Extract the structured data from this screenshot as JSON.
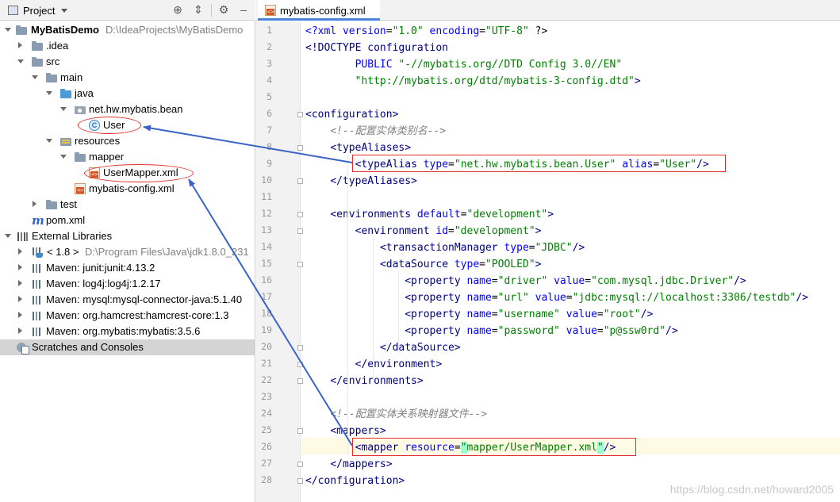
{
  "project_panel": {
    "title": "Project",
    "tree": [
      {
        "label": "MyBatisDemo",
        "path": "D:\\IdeaProjects\\MyBatisDemo"
      },
      {
        "label": ".idea"
      },
      {
        "label": "src"
      },
      {
        "label": "main"
      },
      {
        "label": "java"
      },
      {
        "label": "net.hw.mybatis.bean"
      },
      {
        "label": "User"
      },
      {
        "label": "resources"
      },
      {
        "label": "mapper"
      },
      {
        "label": "UserMapper.xml"
      },
      {
        "label": "mybatis-config.xml"
      },
      {
        "label": "test"
      },
      {
        "label": "pom.xml"
      },
      {
        "label": "External Libraries"
      },
      {
        "label": "< 1.8 >",
        "path": "D:\\Program Files\\Java\\jdk1.8.0_231"
      },
      {
        "label": "Maven: junit:junit:4.13.2"
      },
      {
        "label": "Maven: log4j:log4j:1.2.17"
      },
      {
        "label": "Maven: mysql:mysql-connector-java:5.1.40"
      },
      {
        "label": "Maven: org.hamcrest:hamcrest-core:1.3"
      },
      {
        "label": "Maven: org.mybatis:mybatis:3.5.6"
      },
      {
        "label": "Scratches and Consoles"
      }
    ]
  },
  "editor": {
    "tab_label": "mybatis-config.xml",
    "line_numbers": [
      "1",
      "2",
      "3",
      "4",
      "5",
      "6",
      "7",
      "8",
      "9",
      "10",
      "11",
      "12",
      "13",
      "14",
      "15",
      "16",
      "17",
      "18",
      "19",
      "20",
      "21",
      "22",
      "23",
      "24",
      "25",
      "26",
      "27",
      "28"
    ],
    "lines": [
      [
        [
          "?",
          "<?"
        ],
        [
          "attr",
          "xml version"
        ],
        [
          "",
          "="
        ],
        [
          "val",
          "\"1.0\""
        ],
        [
          "attr",
          " encoding"
        ],
        [
          "",
          "="
        ],
        [
          "val",
          "\"UTF-8\""
        ],
        [
          "",
          " ?>"
        ]
      ],
      [
        [
          "tag",
          "<!DOCTYPE configuration"
        ]
      ],
      [
        [
          "",
          "        "
        ],
        [
          "doc",
          "PUBLIC "
        ],
        [
          "val",
          "\"-//mybatis.org//DTD Config 3.0//EN\""
        ]
      ],
      [
        [
          "",
          "        "
        ],
        [
          "val",
          "\"http://mybatis.org/dtd/mybatis-3-config.dtd\""
        ],
        [
          "tag",
          ">"
        ]
      ],
      [],
      [
        [
          "tag",
          "<configuration>"
        ]
      ],
      [
        [
          "",
          "    "
        ],
        [
          "cmt",
          "<!--配置实体类别名-->"
        ]
      ],
      [
        [
          "",
          "    "
        ],
        [
          "tag",
          "<typeAliases>"
        ]
      ],
      [
        [
          "",
          "        "
        ],
        [
          "tag",
          "<typeAlias"
        ],
        [
          "attr",
          " type"
        ],
        [
          "",
          "="
        ],
        [
          "val",
          "\"net.hw.mybatis.bean.User\""
        ],
        [
          "attr",
          " alias"
        ],
        [
          "",
          "="
        ],
        [
          "val",
          "\"User\""
        ],
        [
          "tag",
          "/>"
        ]
      ],
      [
        [
          "",
          "    "
        ],
        [
          "tag",
          "</typeAliases>"
        ]
      ],
      [],
      [
        [
          "",
          "    "
        ],
        [
          "tag",
          "<environments"
        ],
        [
          "attr",
          " default"
        ],
        [
          "",
          "="
        ],
        [
          "val",
          "\"development\""
        ],
        [
          "tag",
          ">"
        ]
      ],
      [
        [
          "",
          "        "
        ],
        [
          "tag",
          "<environment"
        ],
        [
          "attr",
          " id"
        ],
        [
          "",
          "="
        ],
        [
          "val",
          "\"development\""
        ],
        [
          "tag",
          ">"
        ]
      ],
      [
        [
          "",
          "            "
        ],
        [
          "tag",
          "<transactionManager"
        ],
        [
          "attr",
          " type"
        ],
        [
          "",
          "="
        ],
        [
          "val",
          "\"JDBC\""
        ],
        [
          "tag",
          "/>"
        ]
      ],
      [
        [
          "",
          "            "
        ],
        [
          "tag",
          "<dataSource"
        ],
        [
          "attr",
          " type"
        ],
        [
          "",
          "="
        ],
        [
          "val",
          "\"POOLED\""
        ],
        [
          "tag",
          ">"
        ]
      ],
      [
        [
          "",
          "                "
        ],
        [
          "tag",
          "<property"
        ],
        [
          "attr",
          " name"
        ],
        [
          "",
          "="
        ],
        [
          "val",
          "\"driver\""
        ],
        [
          "attr",
          " value"
        ],
        [
          "",
          "="
        ],
        [
          "val",
          "\"com.mysql.jdbc.Driver\""
        ],
        [
          "tag",
          "/>"
        ]
      ],
      [
        [
          "",
          "                "
        ],
        [
          "tag",
          "<property"
        ],
        [
          "attr",
          " name"
        ],
        [
          "",
          "="
        ],
        [
          "val",
          "\"url\""
        ],
        [
          "attr",
          " value"
        ],
        [
          "",
          "="
        ],
        [
          "val",
          "\"jdbc:mysql://localhost:3306/testdb\""
        ],
        [
          "tag",
          "/>"
        ]
      ],
      [
        [
          "",
          "                "
        ],
        [
          "tag",
          "<property"
        ],
        [
          "attr",
          " name"
        ],
        [
          "",
          "="
        ],
        [
          "val",
          "\"username\""
        ],
        [
          "attr",
          " value"
        ],
        [
          "",
          "="
        ],
        [
          "val",
          "\"root\""
        ],
        [
          "tag",
          "/>"
        ]
      ],
      [
        [
          "",
          "                "
        ],
        [
          "tag",
          "<property"
        ],
        [
          "attr",
          " name"
        ],
        [
          "",
          "="
        ],
        [
          "val",
          "\"password\""
        ],
        [
          "attr",
          " value"
        ],
        [
          "",
          "="
        ],
        [
          "val",
          "\"p@ssw0rd\""
        ],
        [
          "tag",
          "/>"
        ]
      ],
      [
        [
          "",
          "            "
        ],
        [
          "tag",
          "</dataSource>"
        ]
      ],
      [
        [
          "",
          "        "
        ],
        [
          "tag",
          "</environment>"
        ]
      ],
      [
        [
          "",
          "    "
        ],
        [
          "tag",
          "</environments>"
        ]
      ],
      [],
      [
        [
          "",
          "    "
        ],
        [
          "cmt",
          "<!--配置实体关系映射器文件-->"
        ]
      ],
      [
        [
          "",
          "    "
        ],
        [
          "tag",
          "<mappers>"
        ]
      ],
      [
        [
          "",
          "        "
        ],
        [
          "tag",
          "<mapper"
        ],
        [
          "attr",
          " resource"
        ],
        [
          "",
          "="
        ],
        [
          "hlq",
          "\""
        ],
        [
          "val",
          "mapper/UserMapper.xml"
        ],
        [
          "hlq",
          "\""
        ],
        [
          "tag",
          "/>"
        ]
      ],
      [
        [
          "",
          "    "
        ],
        [
          "tag",
          "</mappers>"
        ]
      ],
      [
        [
          "tag",
          "</configuration>"
        ]
      ]
    ]
  },
  "watermark": "https://blog.csdn.net/howard2005",
  "colors": {
    "annotation_red": "#e0302a",
    "arrow_blue": "#3a62c9",
    "tag": "#000080",
    "attr": "#0000ff",
    "value": "#008000",
    "comment": "#808080"
  }
}
